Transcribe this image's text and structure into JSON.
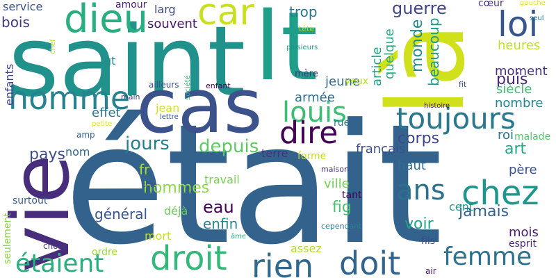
{
  "words": [
    {
      "text": "était",
      "color": "#33638d"
    },
    {
      "text": "saint",
      "color": "#21918c"
    },
    {
      "text": "là",
      "color": "#d0e11c"
    },
    {
      "text": "cas",
      "color": "#3b528b"
    },
    {
      "text": "vie",
      "color": "#472d7b"
    },
    {
      "text": "lt",
      "color": "#1f9e89"
    },
    {
      "text": "dieu",
      "color": "#28ae80"
    },
    {
      "text": "car",
      "color": "#c8e020"
    },
    {
      "text": "loi",
      "color": "#39568c"
    },
    {
      "text": "homme",
      "color": "#26828e"
    },
    {
      "text": "toujours",
      "color": "#2a788e"
    },
    {
      "text": "louis",
      "color": "#3dbc74"
    },
    {
      "text": "dire",
      "color": "#440154"
    },
    {
      "text": "chez",
      "color": "#1f968b"
    },
    {
      "text": "ans",
      "color": "#2d708e"
    },
    {
      "text": "droit",
      "color": "#35b779"
    },
    {
      "text": "doit",
      "color": "#32648e"
    },
    {
      "text": "rien",
      "color": "#31688e"
    },
    {
      "text": "étaient",
      "color": "#29af7f"
    },
    {
      "text": "femme",
      "color": "#2c728e"
    },
    {
      "text": "corps",
      "color": "#3f4788"
    },
    {
      "text": "jours",
      "color": "#277f8e"
    },
    {
      "text": "depuis",
      "color": "#5ec962"
    },
    {
      "text": "pays",
      "color": "#3e4c8a"
    },
    {
      "text": "bois",
      "color": "#443a83"
    },
    {
      "text": "trop",
      "color": "#2a768e"
    },
    {
      "text": "guerre",
      "color": "#414487"
    },
    {
      "text": "monde",
      "color": "#238a8d"
    },
    {
      "text": "article",
      "color": "#1fa088"
    },
    {
      "text": "quelque",
      "color": "#25ab82"
    },
    {
      "text": "beaucoup",
      "color": "#1e9b8a"
    },
    {
      "text": "puis",
      "color": "#482576"
    },
    {
      "text": "art",
      "color": "#22a785"
    },
    {
      "text": "hommes",
      "color": "#8fd744"
    },
    {
      "text": "général",
      "color": "#3a548c"
    },
    {
      "text": "eau",
      "color": "#440256"
    },
    {
      "text": "fig",
      "color": "#4ac16d"
    },
    {
      "text": "voir",
      "color": "#20a386"
    },
    {
      "text": "jamais",
      "color": "#34618d"
    },
    {
      "text": "ville",
      "color": "#75d054"
    },
    {
      "text": "français",
      "color": "#3c4f8a"
    },
    {
      "text": "haut",
      "color": "#2f6c8e"
    },
    {
      "text": "enfin",
      "color": "#24868e"
    },
    {
      "text": "mois",
      "color": "#481b6d"
    },
    {
      "text": "heures",
      "color": "#c0df25"
    },
    {
      "text": "moment",
      "color": "#46337f"
    },
    {
      "text": "siècle",
      "color": "#3fbc73"
    },
    {
      "text": "nombre",
      "color": "#25848e"
    },
    {
      "text": "roi",
      "color": "#2b758e"
    },
    {
      "text": "père",
      "color": "#3b518b"
    },
    {
      "text": "cent",
      "color": "#1f9a8a"
    },
    {
      "text": "jeune",
      "color": "#306a8e"
    },
    {
      "text": "armée",
      "color": "#2e6e8e"
    },
    {
      "text": "effet",
      "color": "#2c738e"
    },
    {
      "text": "jean",
      "color": "#d2e21b"
    },
    {
      "text": "fr",
      "color": "#a5db36"
    },
    {
      "text": "nom",
      "color": "#31678e"
    },
    {
      "text": "enfants",
      "color": "#414387"
    },
    {
      "text": "gt",
      "color": "#23898e"
    },
    {
      "text": "souvent",
      "color": "#481769"
    },
    {
      "text": "larg",
      "color": "#3e4989"
    },
    {
      "text": "amour",
      "color": "#482475"
    },
    {
      "text": "service",
      "color": "#3a538b"
    },
    {
      "text": "yeux",
      "color": "#b8de29"
    },
    {
      "text": "cœur",
      "color": "#453781"
    },
    {
      "text": "gauche",
      "color": "#eae51a"
    },
    {
      "text": "seul",
      "color": "#2a778e"
    },
    {
      "text": "tête",
      "color": "#bddf26"
    },
    {
      "text": "plusieurs",
      "color": "#1f988b"
    },
    {
      "text": "mère",
      "color": "#46307e"
    },
    {
      "text": "fit",
      "color": "#3d4d8a"
    },
    {
      "text": "histoire",
      "color": "#481a6c"
    },
    {
      "text": "malade",
      "color": "#52c569"
    },
    {
      "text": "travail",
      "color": "#7ad151"
    },
    {
      "text": "terre",
      "color": "#46327e"
    },
    {
      "text": "forme",
      "color": "#c2df23"
    },
    {
      "text": "rue",
      "color": "#2b748e"
    },
    {
      "text": "tant",
      "color": "#440154"
    },
    {
      "text": "maison",
      "color": "#46327e"
    },
    {
      "text": "cependant",
      "color": "#26818e"
    },
    {
      "text": "âme",
      "color": "#2fb47c"
    },
    {
      "text": "assez",
      "color": "#b5de2b"
    },
    {
      "text": "fils",
      "color": "#3e4a89"
    },
    {
      "text": "esprit",
      "color": "#482677"
    },
    {
      "text": "air",
      "color": "#471365"
    },
    {
      "text": "ordre",
      "color": "#9bd93c"
    },
    {
      "text": "chose",
      "color": "#453882"
    },
    {
      "text": "mort",
      "color": "#c5e021"
    },
    {
      "text": "déjà",
      "color": "#6ccd5a"
    },
    {
      "text": "surtout",
      "color": "#365d8d"
    },
    {
      "text": "seulement",
      "color": "#8bd646"
    },
    {
      "text": "côté",
      "color": "#3e4a89"
    },
    {
      "text": "amp",
      "color": "#33628d"
    },
    {
      "text": "petite",
      "color": "#e2e418"
    },
    {
      "text": "lettre",
      "color": "#39558c"
    },
    {
      "text": "main",
      "color": "#433e85"
    },
    {
      "text": "ailleurs",
      "color": "#3b528b"
    },
    {
      "text": "société",
      "color": "#31b57b"
    },
    {
      "text": "enfant",
      "color": "#440154"
    },
    {
      "text": "chef",
      "color": "#b2dd2d"
    }
  ]
}
